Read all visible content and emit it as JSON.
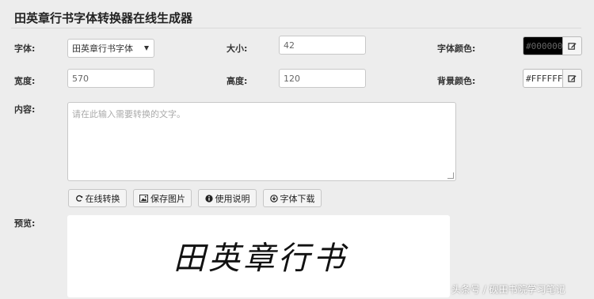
{
  "page": {
    "title": "田英章行书字体转换器在线生成器"
  },
  "form": {
    "font_label": "字体:",
    "font_value": "田英章行书字体",
    "size_label": "大小:",
    "size_value": "42",
    "font_color_label": "字体颜色:",
    "font_color_value": "#000000",
    "width_label": "宽度:",
    "width_value": "570",
    "height_label": "高度:",
    "height_value": "120",
    "bg_color_label": "背景颜色:",
    "bg_color_value": "#FFFFFF",
    "content_label": "内容:",
    "content_placeholder": "请在此输入需要转换的文字。"
  },
  "buttons": {
    "convert": "在线转换",
    "save": "保存图片",
    "help": "使用说明",
    "download": "字体下载"
  },
  "preview": {
    "label": "预览:",
    "text": "田英章行书"
  },
  "watermark": "头条号 / 砚田书院学习笔记",
  "colors": {
    "font_color_swatch": "#000000",
    "bg_color_swatch": "#FFFFFF",
    "page_bg": "#EDEDED"
  },
  "icons": {
    "convert": "refresh-icon",
    "save": "image-icon",
    "help": "info-icon",
    "download": "download-icon",
    "color_picker": "edit-icon",
    "dropdown": "caret-down-icon"
  }
}
